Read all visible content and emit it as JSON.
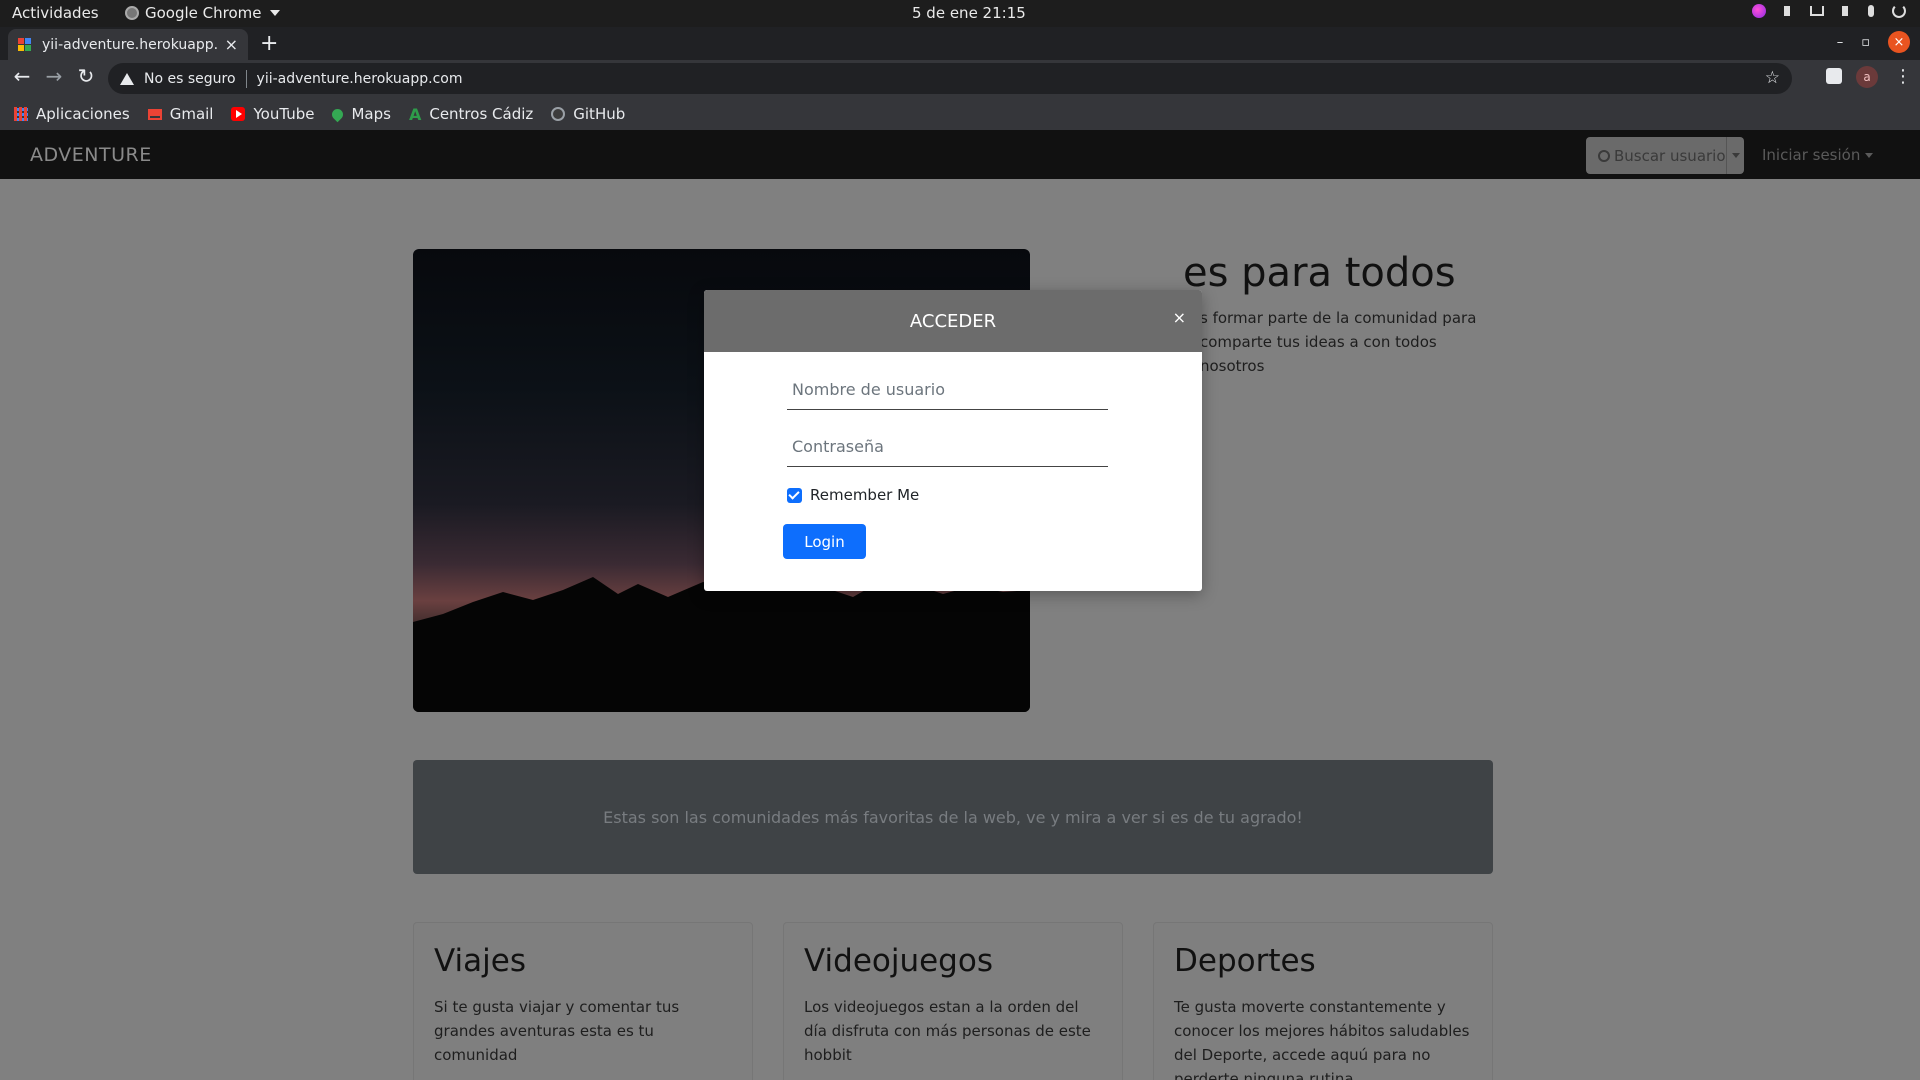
{
  "system_bar": {
    "activities": "Actividades",
    "app_name": "Google Chrome",
    "clock": "5 de ene  21:15"
  },
  "browser": {
    "tab": {
      "title": "yii-adventure.herokuapp.",
      "close": "×"
    },
    "new_tab": "+",
    "omnibox": {
      "security": "No es seguro",
      "url": "yii-adventure.herokuapp.com"
    },
    "profile_initial": "a",
    "window": {
      "minimize": "–",
      "restore": "▫",
      "close": "×"
    },
    "bookmarks": [
      {
        "label": "Aplicaciones",
        "icon": "apps-grid-icon"
      },
      {
        "label": "Gmail",
        "icon": "gmail-icon"
      },
      {
        "label": "YouTube",
        "icon": "youtube-icon"
      },
      {
        "label": "Maps",
        "icon": "maps-icon"
      },
      {
        "label": "Centros Cádiz",
        "icon": "centros-icon"
      },
      {
        "label": "GitHub",
        "icon": "github-icon"
      }
    ]
  },
  "site": {
    "brand": "ADVENTURE",
    "search_placeholder": "Buscar usuario",
    "login_menu": "Iniciar sesión",
    "hero": {
      "title": "es para todos",
      "text_line1": "s formar parte de la comunidad para",
      "text_line2": "comparte tus ideas a con todos nosotros"
    },
    "banner": "Estas son las comunidades más favoritas de la web, ve y mira a ver si es de tu agrado!",
    "cards": [
      {
        "title": "Viajes",
        "text": "Si te gusta viajar y comentar tus grandes aventuras esta es tu comunidad"
      },
      {
        "title": "Videojuegos",
        "text": "Los videojuegos estan a la orden del día disfruta con más personas de este hobbit"
      },
      {
        "title": "Deportes",
        "text": "Te gusta moverte constantemente y conocer los mejores hábitos saludables del Deporte, accede aquú para no perderte ninguna rutina"
      }
    ]
  },
  "modal": {
    "title": "ACCEDER",
    "close": "×",
    "username_placeholder": "Nombre de usuario",
    "password_placeholder": "Contraseña",
    "remember_label": "Remember Me",
    "remember_checked": true,
    "login_button": "Login"
  },
  "colors": {
    "primary": "#0d6efd",
    "modal_header": "#6c6c6c",
    "overlay_page": "#808080",
    "ubuntu_close": "#e95420"
  }
}
